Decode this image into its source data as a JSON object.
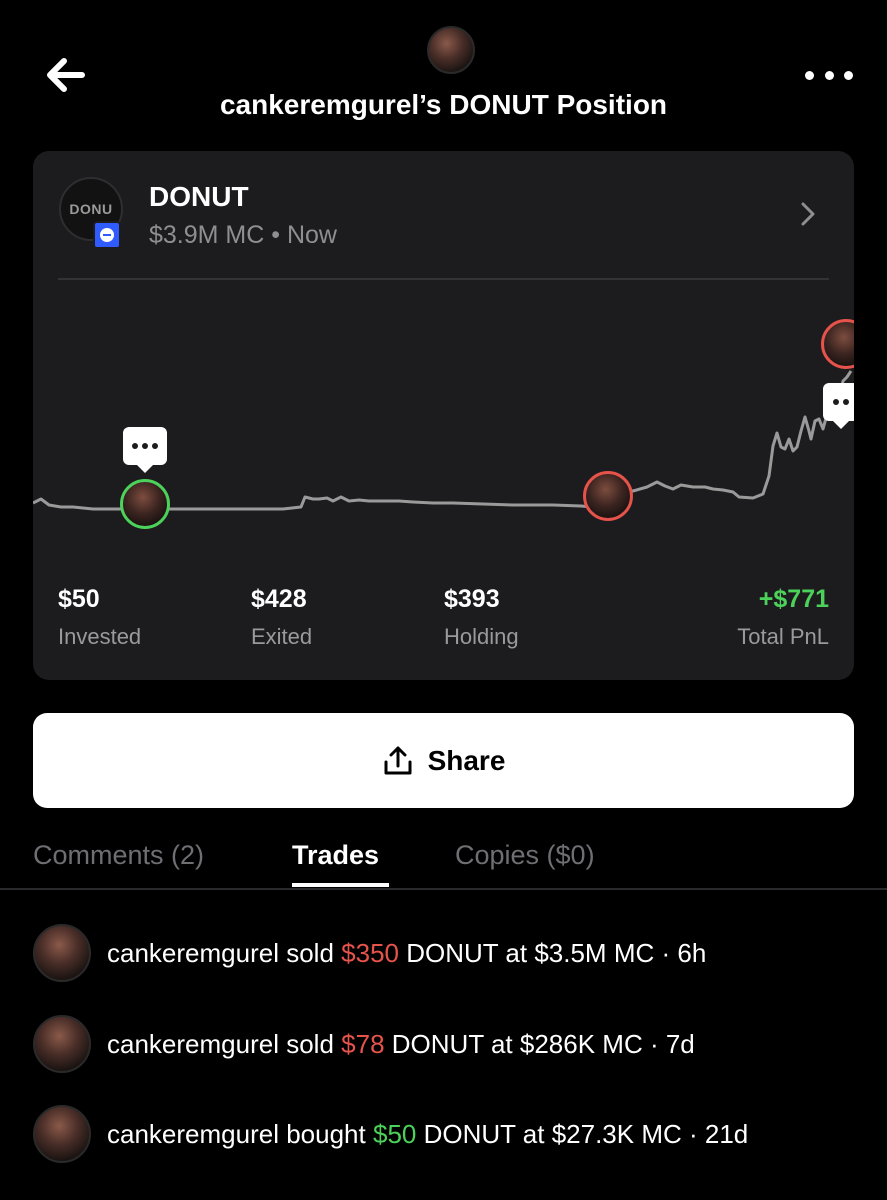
{
  "header": {
    "title": "cankeremgurel’s DONUT Position"
  },
  "token": {
    "logo_text": "DONU",
    "name": "DONUT",
    "meta": "$3.9M MC • Now"
  },
  "chart": {
    "line_color": "#9a9a9a",
    "buy_marker_color": "#4cd25a",
    "sell_marker_color": "#e5534b"
  },
  "stats": [
    {
      "value": "$50",
      "label": "Invested"
    },
    {
      "value": "$428",
      "label": "Exited"
    },
    {
      "value": "$393",
      "label": "Holding"
    },
    {
      "value": "+$771",
      "label": "Total PnL"
    }
  ],
  "share": {
    "label": "Share"
  },
  "tabs": [
    {
      "label": "Comments (2)",
      "active": false
    },
    {
      "label": "Trades",
      "active": true
    },
    {
      "label": "Copies ($0)",
      "active": false
    }
  ],
  "trades": [
    {
      "user": "cankeremgurel",
      "action": "sold",
      "amount": "$350",
      "rest": "DONUT at $3.5M MC · 6h"
    },
    {
      "user": "cankeremgurel",
      "action": "sold",
      "amount": "$78",
      "rest": "DONUT at $286K MC · 7d"
    },
    {
      "user": "cankeremgurel",
      "action": "bought",
      "amount": "$50",
      "rest": "DONUT at $27.3K MC · 21d"
    }
  ],
  "colors": {
    "background": "#000000",
    "card": "#1c1c1e",
    "positive": "#4cd25a",
    "negative": "#e5534b"
  }
}
